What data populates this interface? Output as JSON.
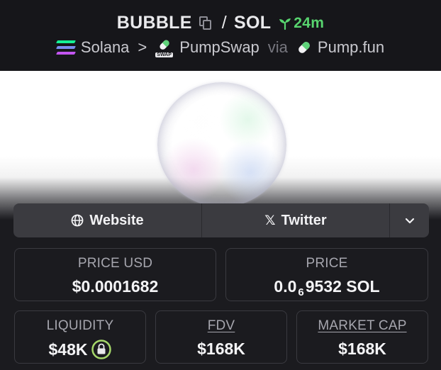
{
  "header": {
    "token_symbol": "BUBBLE",
    "separator": "/",
    "quote_symbol": "SOL",
    "age": "24m",
    "chain": "Solana",
    "chevron": ">",
    "dex": "PumpSwap",
    "dex_tag": "SWAP",
    "via": "via",
    "launchpad": "Pump.fun"
  },
  "links": {
    "website_label": "Website",
    "twitter_icon_glyph": "𝕏",
    "twitter_label": "Twitter"
  },
  "stats": {
    "price_usd_label": "PRICE USD",
    "price_usd_value": "$0.0001682",
    "price_label": "PRICE",
    "price_prefix": "0.0",
    "price_zero_count": "6",
    "price_suffix": "9532 SOL",
    "liquidity_label": "LIQUIDITY",
    "liquidity_value": "$48K",
    "fdv_label": "FDV",
    "fdv_value": "$168K",
    "market_cap_label": "MARKET CAP",
    "market_cap_value": "$168K"
  },
  "colors": {
    "accent_green": "#58d46f",
    "background": "#1b1b1f",
    "header_bg": "#16161a",
    "card_border": "#3a3a40",
    "link_bar_bg": "#3b3b40"
  },
  "icons": [
    "copy-icon",
    "sprout-icon",
    "solana-icon",
    "pumpswap-icon",
    "pill-icon",
    "globe-icon",
    "x-icon",
    "chevron-down-icon",
    "lock-icon"
  ]
}
